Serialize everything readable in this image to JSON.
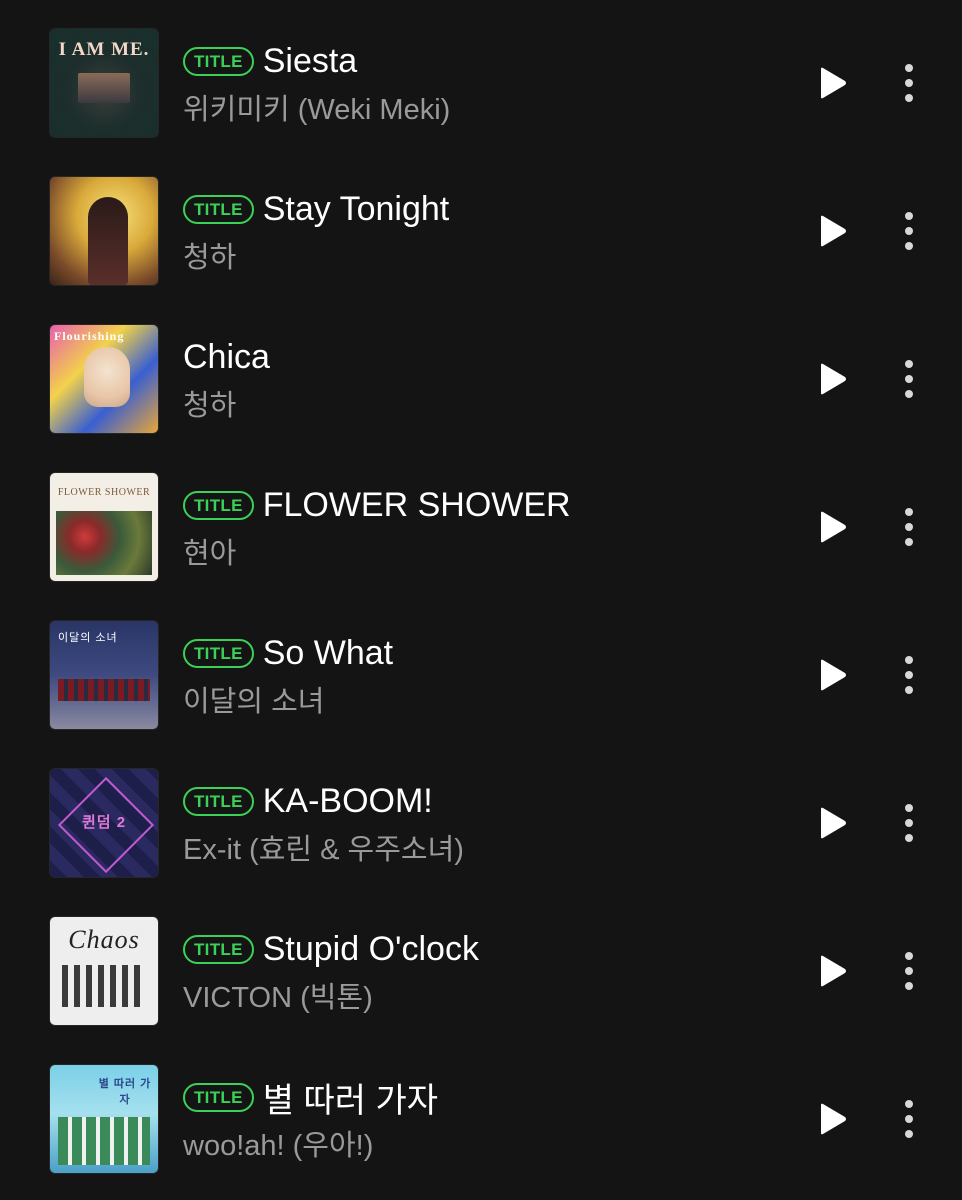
{
  "colors": {
    "background": "#141414",
    "title_badge": "#3bd159",
    "song_title": "#ffffff",
    "artist": "#9a9a9a"
  },
  "icons": {
    "play": "play-icon",
    "more": "more-vertical-icon"
  },
  "songs": [
    {
      "badge": "TITLE",
      "title": "Siesta",
      "artist": "위키미키 (Weki Meki)",
      "album_text": "I AM ME."
    },
    {
      "badge": "TITLE",
      "title": "Stay Tonight",
      "artist": "청하",
      "album_text": ""
    },
    {
      "badge": "",
      "title": "Chica",
      "artist": "청하",
      "album_text": "Flourishing"
    },
    {
      "badge": "TITLE",
      "title": "FLOWER SHOWER",
      "artist": "현아",
      "album_text": "FLOWER SHOWER"
    },
    {
      "badge": "TITLE",
      "title": "So What",
      "artist": "이달의 소녀",
      "album_text": "이달의 소녀"
    },
    {
      "badge": "TITLE",
      "title": "KA-BOOM!",
      "artist": "Ex-it (효린 & 우주소녀)",
      "album_text": "퀸덤 2"
    },
    {
      "badge": "TITLE",
      "title": "Stupid O'clock",
      "artist": "VICTON (빅톤)",
      "album_text": "Chaos"
    },
    {
      "badge": "TITLE",
      "title": "별 따러 가자",
      "artist": "woo!ah! (우아!)",
      "album_text": "별 따러 가자"
    }
  ]
}
